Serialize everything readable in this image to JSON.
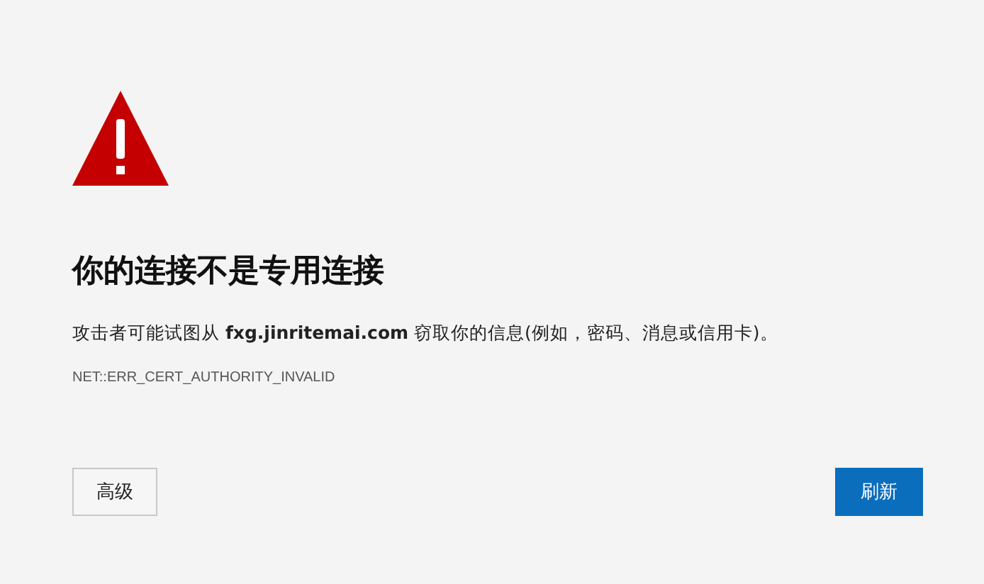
{
  "title": "你的连接不是专用连接",
  "description": "攻击者可能试图从 **fxg.jinritemai.com** 窃取你的信息(例如，密码、消息或信用卡)。",
  "error_code": "NET::ERR_CERT_AUTHORITY_INVALID",
  "buttons": [
    {
      "label": "高级",
      "kind": "secondary"
    },
    {
      "label": "刷新",
      "kind": "primary"
    }
  ]
}
